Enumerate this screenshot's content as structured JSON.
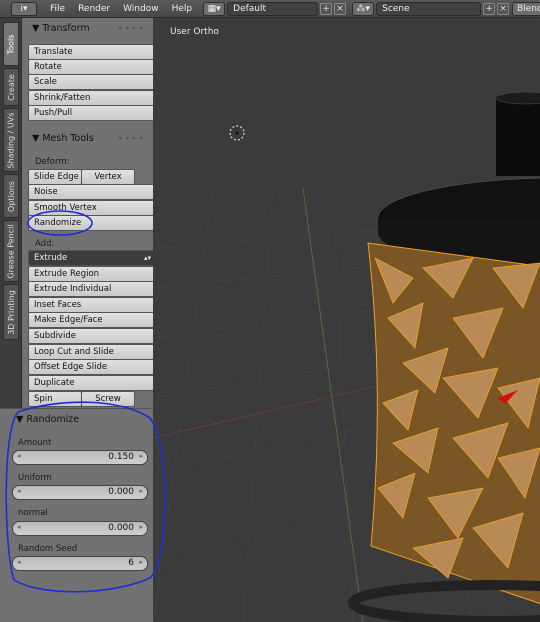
{
  "menubar": {
    "info_icon": "i",
    "menus": [
      "File",
      "Render",
      "Window",
      "Help"
    ],
    "screen_layout": "Default",
    "scene": "Scene",
    "engine": "Blend"
  },
  "tabs": [
    "Tools",
    "Create",
    "Shading / UVs",
    "Options",
    "Grease Pencil",
    "3D Printing"
  ],
  "transform": {
    "title": "Transform",
    "buttons": [
      "Translate",
      "Rotate",
      "Scale",
      "Shrink/Fatten",
      "Push/Pull"
    ]
  },
  "mesh_tools": {
    "title": "Mesh Tools",
    "deform_label": "Deform:",
    "slide_edge": "Slide Edge",
    "vertex": "Vertex",
    "noise": "Noise",
    "smooth_vertex": "Smooth Vertex",
    "randomize": "Randomize",
    "add_label": "Add:",
    "extrude": "Extrude",
    "add_buttons": [
      "Extrude Region",
      "Extrude Individual",
      "Inset Faces",
      "Make Edge/Face",
      "Subdivide",
      "Loop Cut and Slide",
      "Offset Edge Slide",
      "Duplicate"
    ],
    "spin": "Spin",
    "screw": "Screw"
  },
  "redo_panel": {
    "title": "Randomize",
    "amount_label": "Amount",
    "amount_value": "0.150",
    "uniform_label": "Uniform",
    "uniform_value": "0.000",
    "normal_label": "normal",
    "normal_value": "0.000",
    "seed_label": "Random Seed",
    "seed_value": "6"
  },
  "viewport": {
    "label": "User Ortho"
  },
  "colors": {
    "selection_orange": "#f0a020",
    "annotation_blue": "#1a2fd6",
    "panel_gray": "#727272",
    "viewport_gray": "#3b3b3b"
  }
}
